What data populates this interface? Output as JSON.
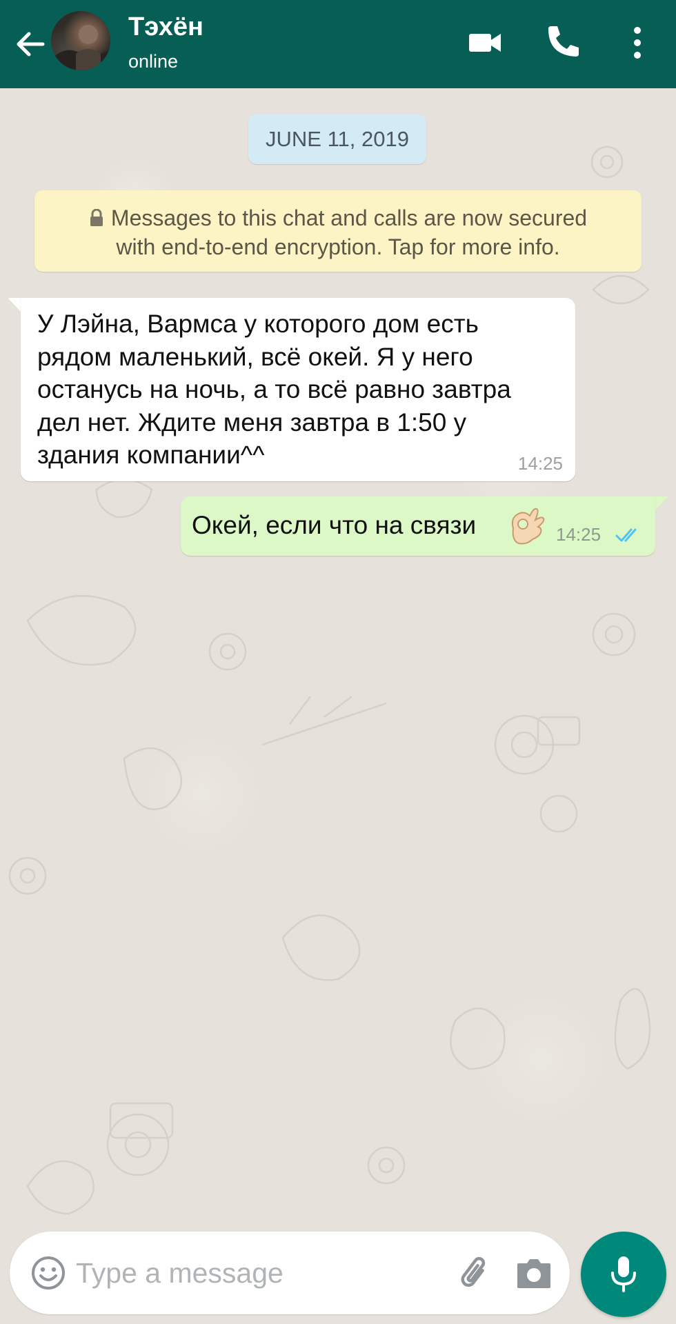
{
  "header": {
    "back_icon": "arrow-left-icon",
    "contact_name": "Тэхён",
    "status": "online",
    "actions": [
      "video-call-icon",
      "phone-icon",
      "more-vert-icon"
    ],
    "background_color": "#075e54"
  },
  "chat": {
    "date_chip": "JUNE 11, 2019",
    "encryption_notice": {
      "line1": "Messages to this chat and calls are now secured",
      "line2": "with end-to-end encryption. Tap for more info.",
      "icon": "lock-icon"
    },
    "messages": [
      {
        "direction": "incoming",
        "text": "У Лэйна, Вармса у которого дом есть\nрядом маленький, всё окей. Я у него\nостанусь на ночь, а то всё равно завтра\nдел нет. Ждите меня завтра в 1:50 у\nздания компании^^",
        "time": "14:25"
      },
      {
        "direction": "outgoing",
        "text": "Окей, если что на связи",
        "emoji": "ok-hand",
        "time": "14:25",
        "status": "read",
        "status_icon": "double-check-icon"
      }
    ]
  },
  "composer": {
    "placeholder": "Type a message",
    "value": "",
    "emoji_icon": "smiley-icon",
    "attach_icon": "paperclip-icon",
    "camera_icon": "camera-icon",
    "mic_icon": "mic-icon"
  },
  "colors": {
    "incoming_bubble": "#ffffff",
    "outgoing_bubble": "#dcf8c6",
    "date_chip": "#d4eaf4",
    "notice": "#fcf4c4",
    "mic_button": "#00897b",
    "read_ticks": "#4fc3f7"
  }
}
